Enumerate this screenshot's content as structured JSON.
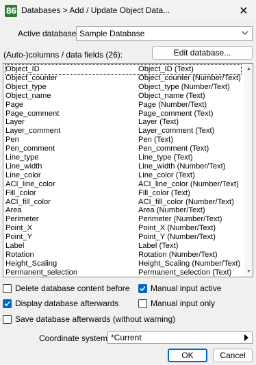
{
  "window": {
    "title": "Databases > Add / Update Object Data...",
    "app_icon": "86",
    "close_glyph": "✕"
  },
  "active_database": {
    "label": "Active database:",
    "value": "Sample Database"
  },
  "fields_label": "(Auto-)columns / data fields (26):",
  "edit_database_button": "Edit database...",
  "fields": [
    {
      "name": "Object_ID",
      "type": "Object_ID (Text)"
    },
    {
      "name": "Object_counter",
      "type": "Object_counter (Number/Text)"
    },
    {
      "name": "Object_type",
      "type": "Object_type (Number/Text)"
    },
    {
      "name": "Object_name",
      "type": "Object_name (Text)"
    },
    {
      "name": "Page",
      "type": "Page (Number/Text)"
    },
    {
      "name": "Page_comment",
      "type": "Page_comment (Text)"
    },
    {
      "name": "Layer",
      "type": "Layer (Text)"
    },
    {
      "name": "Layer_comment",
      "type": "Layer_comment (Text)"
    },
    {
      "name": "Pen",
      "type": "Pen (Text)"
    },
    {
      "name": "Pen_comment",
      "type": "Pen_comment (Text)"
    },
    {
      "name": "Line_type",
      "type": "Line_type (Text)"
    },
    {
      "name": "Line_width",
      "type": "Line_width (Number/Text)"
    },
    {
      "name": "Line_color",
      "type": "Line_color (Text)"
    },
    {
      "name": "ACI_line_color",
      "type": "ACI_line_color (Number/Text)"
    },
    {
      "name": "Fill_color",
      "type": "Fill_color (Text)"
    },
    {
      "name": "ACI_fill_color",
      "type": "ACI_fill_color (Number/Text)"
    },
    {
      "name": "Area",
      "type": "Area (Number/Text)"
    },
    {
      "name": "Perimeter",
      "type": "Perimeter (Number/Text)"
    },
    {
      "name": "Point_X",
      "type": "Point_X (Number/Text)"
    },
    {
      "name": "Point_Y",
      "type": "Point_Y (Number/Text)"
    },
    {
      "name": "Label",
      "type": "Label (Text)"
    },
    {
      "name": "Rotation",
      "type": "Rotation (Number/Text)"
    },
    {
      "name": "Height_Scaling",
      "type": "Height_Scaling (Number/Text)"
    },
    {
      "name": "Permanent_selection",
      "type": "Permanent_selection (Text)"
    }
  ],
  "options": {
    "delete_content": {
      "label": "Delete database content before",
      "checked": false
    },
    "manual_input_active": {
      "label": "Manual input active",
      "checked": true
    },
    "display_afterwards": {
      "label": "Display database afterwards",
      "checked": true
    },
    "manual_input_only": {
      "label": "Manual input only",
      "checked": false
    },
    "save_afterwards": {
      "label": "Save database afterwards (without warning)",
      "checked": false
    }
  },
  "coordinate_system": {
    "label": "Coordinate system:",
    "value": "*Current"
  },
  "buttons": {
    "ok": "OK",
    "cancel": "Cancel"
  },
  "colors": {
    "accent": "#0067c0",
    "background": "#f0f0f0"
  }
}
